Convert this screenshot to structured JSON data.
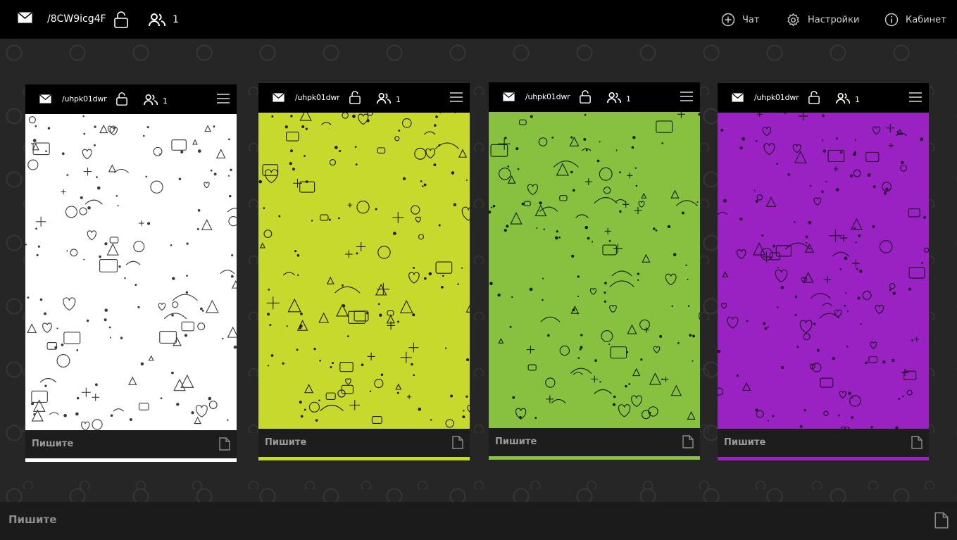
{
  "topbar": {
    "room": "/8CW9icg4F",
    "participants": "1",
    "nav": [
      {
        "label": "Чат",
        "icon": "plus-circle-icon"
      },
      {
        "label": "Настройки",
        "icon": "gear-icon"
      },
      {
        "label": "Кабинет",
        "icon": "info-icon"
      }
    ]
  },
  "previews": [
    {
      "room": "/uhpk01dwr",
      "participants": "1",
      "placeholder": "Пишите",
      "bg": "#ffffff",
      "line": "#3a3a3a"
    },
    {
      "room": "/uhpk01dwr",
      "participants": "1",
      "placeholder": "Пишите",
      "bg": "#c6d92c",
      "line": "#1c1f05"
    },
    {
      "room": "/uhpk01dwr",
      "participants": "1",
      "placeholder": "Пишите",
      "bg": "#87c13f",
      "line": "#10220a"
    },
    {
      "room": "/uhpk01dwr",
      "participants": "1",
      "placeholder": "Пишите",
      "bg": "#9a22c2",
      "line": "#1c0626"
    }
  ],
  "composer": {
    "placeholder": "Пишите"
  }
}
